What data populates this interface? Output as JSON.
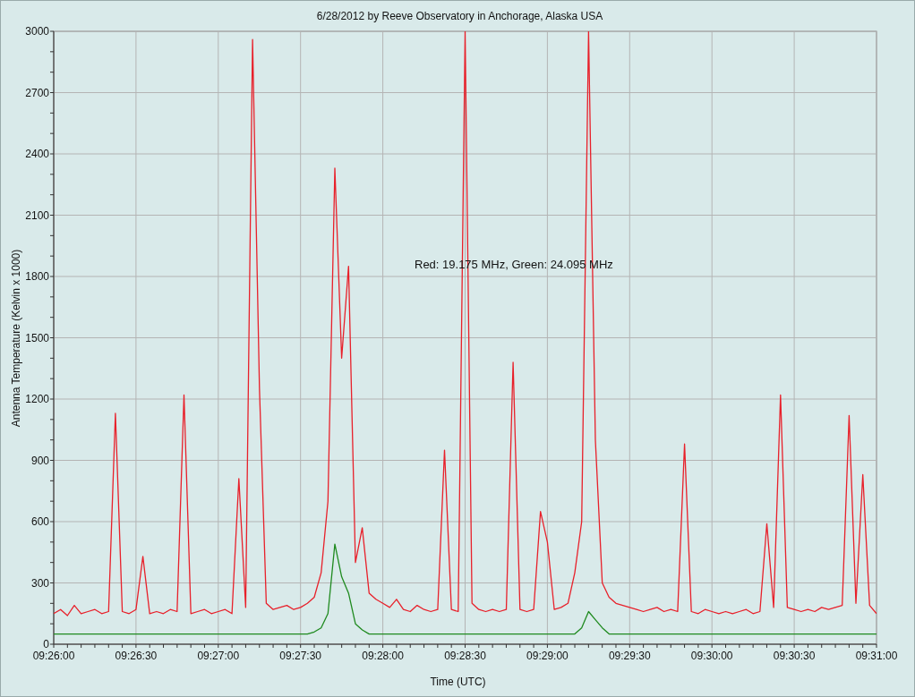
{
  "chart": {
    "chart_data": {
      "type": "line",
      "title": "6/28/2012  by  Reeve Observatory  in  Anchorage, Alaska  USA",
      "xlabel": "Time (UTC)",
      "ylabel": "Antenna Temperature (Kelvin x 1000)",
      "categories": [
        "09:26:00",
        null,
        null,
        null,
        null,
        null,
        null,
        null,
        null,
        null,
        null,
        null,
        "09:26:30",
        null,
        null,
        null,
        null,
        null,
        null,
        null,
        null,
        null,
        null,
        null,
        "09:27:00",
        null,
        null,
        null,
        null,
        null,
        null,
        null,
        null,
        null,
        null,
        null,
        "09:27:30",
        null,
        null,
        null,
        null,
        null,
        null,
        null,
        null,
        null,
        null,
        null,
        "09:28:00",
        null,
        null,
        null,
        null,
        null,
        null,
        null,
        null,
        null,
        null,
        null,
        "09:28:30",
        null,
        null,
        null,
        null,
        null,
        null,
        null,
        null,
        null,
        null,
        null,
        "09:29:00",
        null,
        null,
        null,
        null,
        null,
        null,
        null,
        null,
        null,
        null,
        null,
        "09:29:30",
        null,
        null,
        null,
        null,
        null,
        null,
        null,
        null,
        null,
        null,
        null,
        "09:30:00",
        null,
        null,
        null,
        null,
        null,
        null,
        null,
        null,
        null,
        null,
        null,
        "09:30:30",
        null,
        null,
        null,
        null,
        null,
        null,
        null,
        null,
        null,
        null,
        null,
        "09:31:00"
      ],
      "series": [
        {
          "color": "#e8202a",
          "values": [
            150,
            170,
            140,
            190,
            150,
            160,
            170,
            150,
            160,
            1130,
            160,
            150,
            170,
            430,
            150,
            160,
            150,
            170,
            160,
            1220,
            150,
            160,
            170,
            150,
            160,
            170,
            150,
            810,
            180,
            2960,
            1250,
            200,
            170,
            180,
            190,
            170,
            180,
            200,
            230,
            350,
            700,
            2330,
            1400,
            1850,
            400,
            570,
            250,
            220,
            200,
            180,
            220,
            170,
            160,
            190,
            170,
            160,
            170,
            950,
            170,
            160,
            3000,
            200,
            170,
            160,
            170,
            160,
            170,
            1380,
            170,
            160,
            170,
            650,
            500,
            170,
            180,
            200,
            350,
            600,
            3000,
            1000,
            300,
            230,
            200,
            190,
            180,
            170,
            160,
            170,
            180,
            160,
            170,
            160,
            980,
            160,
            150,
            170,
            160,
            150,
            160,
            150,
            160,
            170,
            150,
            160,
            590,
            180,
            1220,
            180,
            170,
            160,
            170,
            160,
            180,
            170,
            180,
            190,
            1120,
            200,
            830,
            190,
            150
          ]
        },
        {
          "color": "#1f8a1f",
          "values": [
            50,
            50,
            50,
            50,
            50,
            50,
            50,
            50,
            50,
            50,
            50,
            50,
            50,
            50,
            50,
            50,
            50,
            50,
            50,
            50,
            50,
            50,
            50,
            50,
            50,
            50,
            50,
            50,
            50,
            50,
            50,
            50,
            50,
            50,
            50,
            50,
            50,
            50,
            60,
            80,
            150,
            490,
            330,
            250,
            100,
            70,
            50,
            50,
            50,
            50,
            50,
            50,
            50,
            50,
            50,
            50,
            50,
            50,
            50,
            50,
            50,
            50,
            50,
            50,
            50,
            50,
            50,
            50,
            50,
            50,
            50,
            50,
            50,
            50,
            50,
            50,
            50,
            80,
            160,
            120,
            80,
            50,
            50,
            50,
            50,
            50,
            50,
            50,
            50,
            50,
            50,
            50,
            50,
            50,
            50,
            50,
            50,
            50,
            50,
            50,
            50,
            50,
            50,
            50,
            50,
            50,
            50,
            50,
            50,
            50,
            50,
            50,
            50,
            50,
            50,
            50,
            50,
            50,
            50,
            50,
            50
          ]
        }
      ],
      "ylim": [
        0,
        3000
      ],
      "grid": true,
      "yticks": [
        0,
        300,
        600,
        900,
        1200,
        1500,
        1800,
        2100,
        2400,
        2700,
        3000
      ],
      "annotations": [
        "Red: 19.175 MHz, Green: 24.095 MHz"
      ]
    }
  }
}
